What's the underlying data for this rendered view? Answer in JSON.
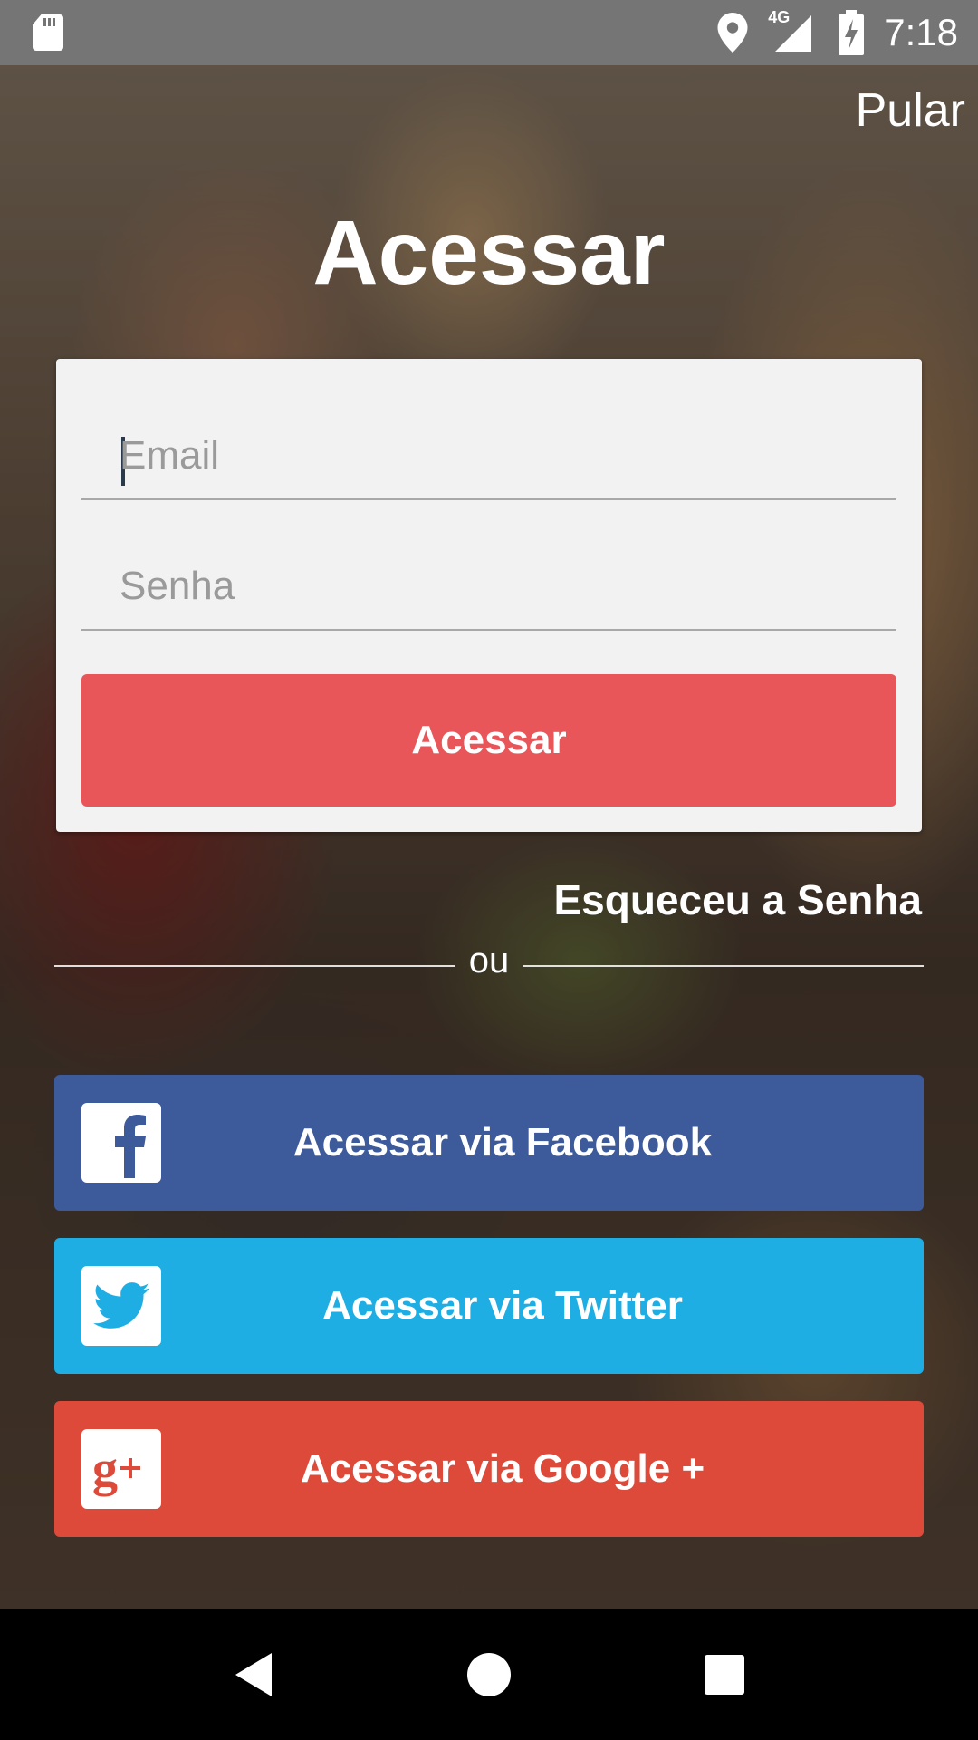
{
  "status_bar": {
    "time": "7:18",
    "network": "4G",
    "icons": [
      "sd-card-icon",
      "location-icon",
      "signal-icon",
      "battery-charging-icon"
    ]
  },
  "header": {
    "skip_label": "Pular",
    "title": "Acessar"
  },
  "login_form": {
    "email_placeholder": "Email",
    "email_value": "",
    "password_placeholder": "Senha",
    "password_value": "",
    "submit_label": "Acessar",
    "submit_color": "#e8565a"
  },
  "forgot_password_label": "Esqueceu a Senha",
  "divider_label": "ou",
  "social_buttons": [
    {
      "label": "Acessar via Facebook",
      "icon": "facebook-icon",
      "color": "#3d5a9a"
    },
    {
      "label": "Acessar via Twitter",
      "icon": "twitter-icon",
      "color": "#1eaee3"
    },
    {
      "label": "Acessar via Google +",
      "icon": "google-plus-icon",
      "color": "#dd4a3a"
    }
  ],
  "nav_bar": {
    "icons": [
      "back-icon",
      "home-icon",
      "recents-icon"
    ]
  }
}
